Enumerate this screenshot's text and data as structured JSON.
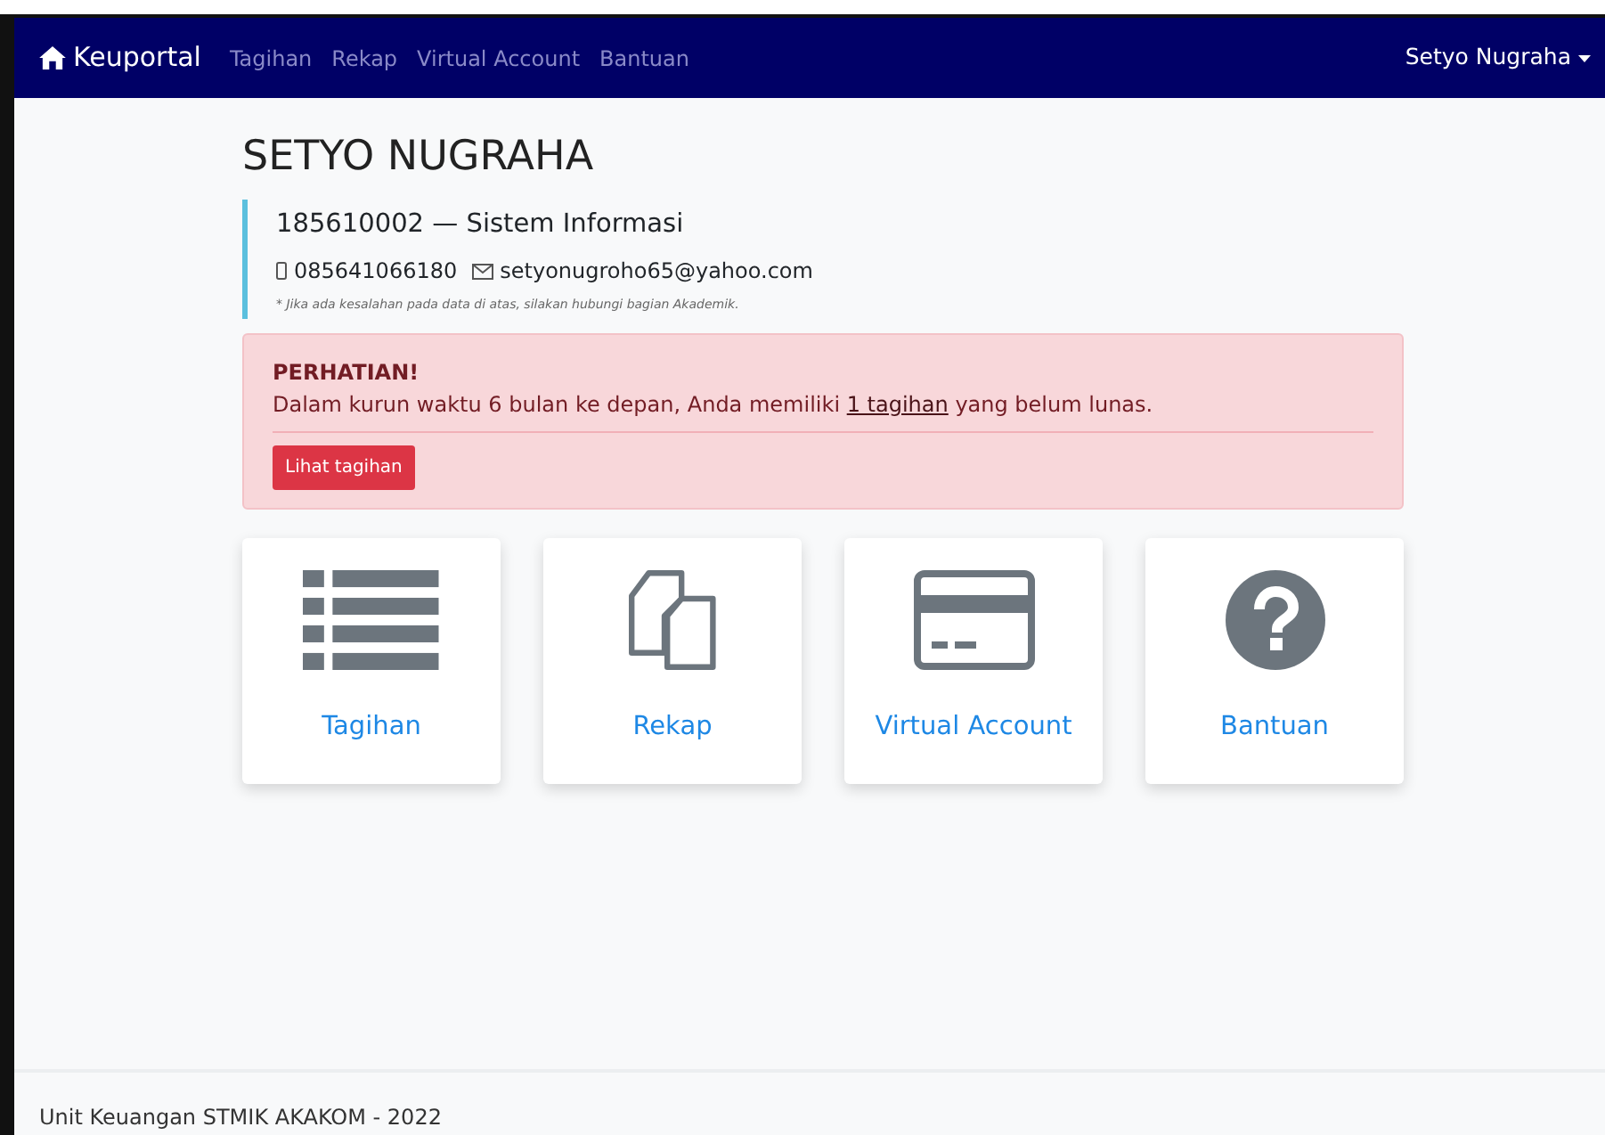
{
  "navbar": {
    "brand": "Keuportal",
    "links": [
      "Tagihan",
      "Rekap",
      "Virtual Account",
      "Bantuan"
    ],
    "user": "Setyo Nugraha"
  },
  "profile": {
    "name": "SETYO NUGRAHA",
    "id_line": "185610002 — Sistem Informasi",
    "phone": "085641066180",
    "email": "setyonugroho65@yahoo.com",
    "note": "* Jika ada kesalahan pada data di atas, silakan hubungi bagian Akademik."
  },
  "alert": {
    "title": "PERHATIAN!",
    "text_before": "Dalam kurun waktu 6 bulan ke depan, Anda memiliki ",
    "link": "1 tagihan",
    "text_after": " yang belum lunas.",
    "button": "Lihat tagihan"
  },
  "tiles": [
    {
      "kind": "list",
      "label": "Tagihan"
    },
    {
      "kind": "copy",
      "label": "Rekap"
    },
    {
      "kind": "card",
      "label": "Virtual Account"
    },
    {
      "kind": "help",
      "label": "Bantuan"
    }
  ],
  "footer": "Unit Keuangan STMIK AKAKOM - 2022"
}
